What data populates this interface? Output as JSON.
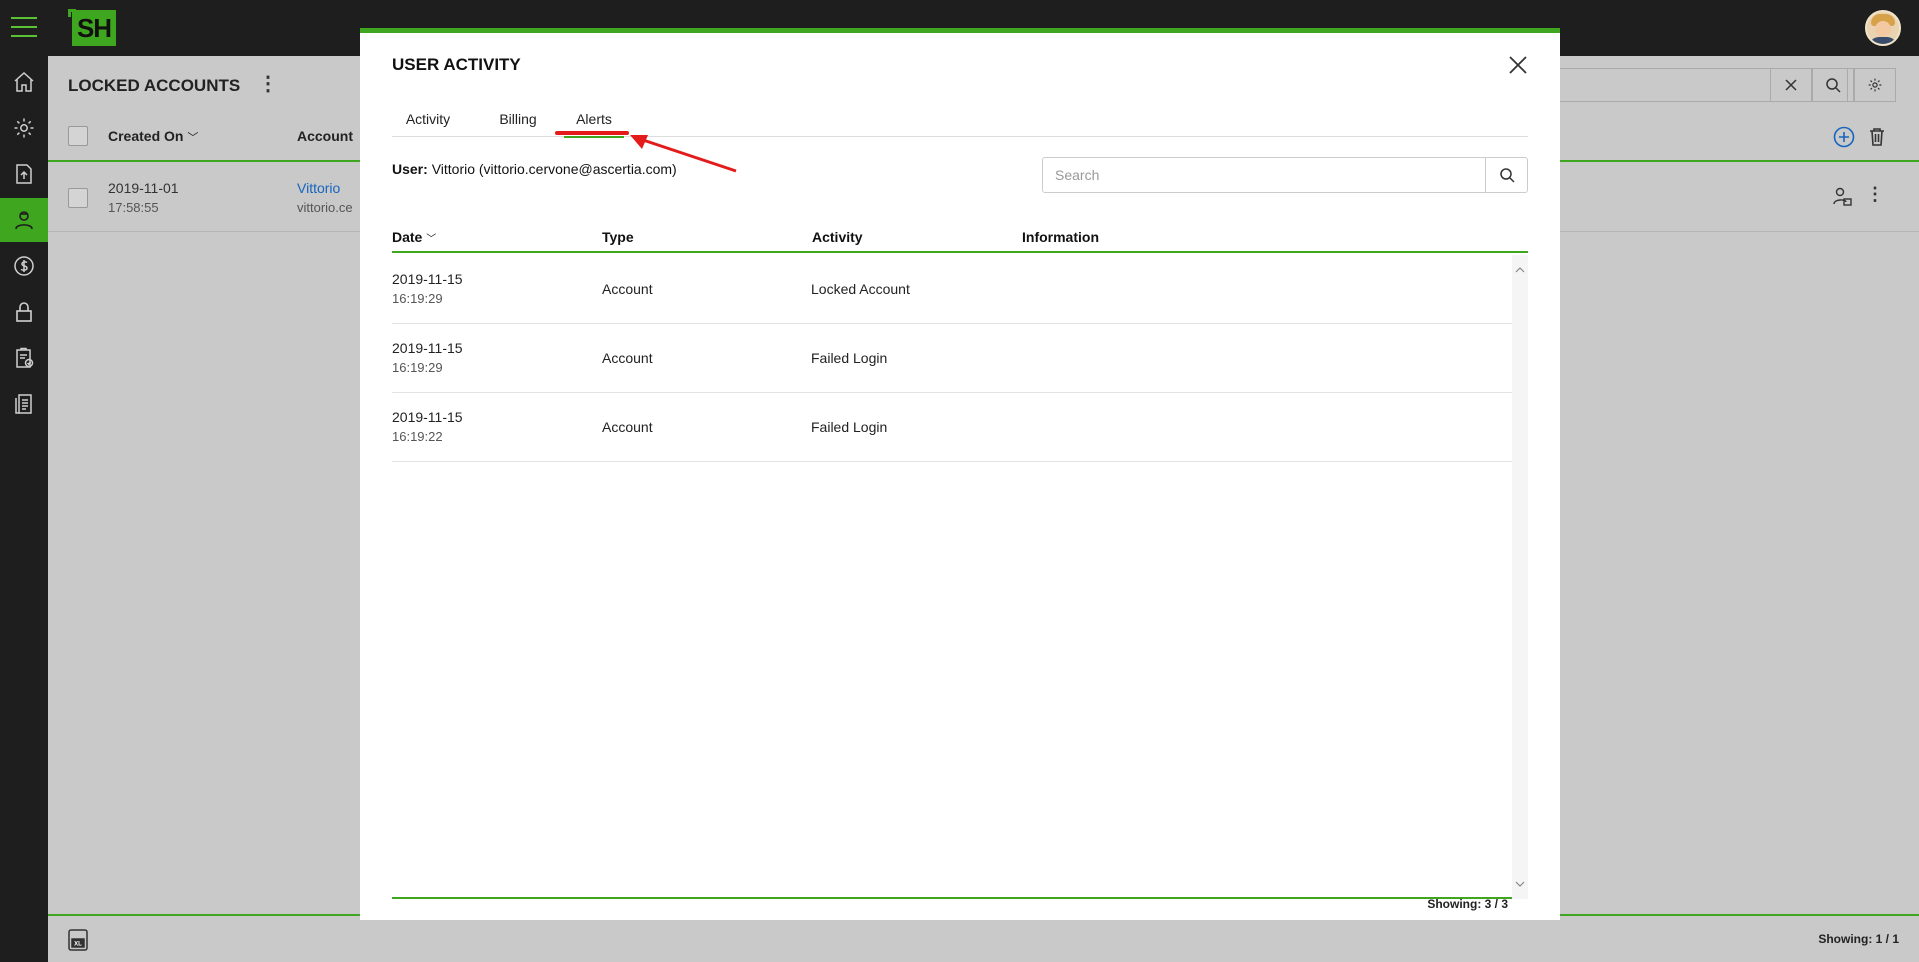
{
  "app": {
    "logo_text": "SH"
  },
  "background": {
    "title": "LOCKED ACCOUNTS",
    "columns": {
      "created_on": "Created On",
      "account": "Account"
    },
    "row": {
      "date": "2019-11-01",
      "time": "17:58:55",
      "account_name": "Vittorio",
      "account_email": "vittorio.ce"
    },
    "footer_showing": "Showing: 1 / 1"
  },
  "modal": {
    "title": "USER ACTIVITY",
    "tabs": [
      {
        "label": "Activity"
      },
      {
        "label": "Billing"
      },
      {
        "label": "Alerts"
      }
    ],
    "active_tab": "Alerts",
    "user_label": "User:",
    "user_value": "Vittorio (vittorio.cervone@ascertia.com)",
    "search_placeholder": "Search",
    "columns": {
      "date": "Date",
      "type": "Type",
      "activity": "Activity",
      "information": "Information"
    },
    "rows": [
      {
        "date": "2019-11-15",
        "time": "16:19:29",
        "type": "Account",
        "activity": "Locked Account",
        "information": ""
      },
      {
        "date": "2019-11-15",
        "time": "16:19:29",
        "type": "Account",
        "activity": "Failed Login",
        "information": ""
      },
      {
        "date": "2019-11-15",
        "time": "16:19:22",
        "type": "Account",
        "activity": "Failed Login",
        "information": ""
      }
    ],
    "showing": "Showing: 3 / 3"
  },
  "colors": {
    "accent": "#3fa61f",
    "annotation": "#e31b1b",
    "link": "#1565c0"
  }
}
